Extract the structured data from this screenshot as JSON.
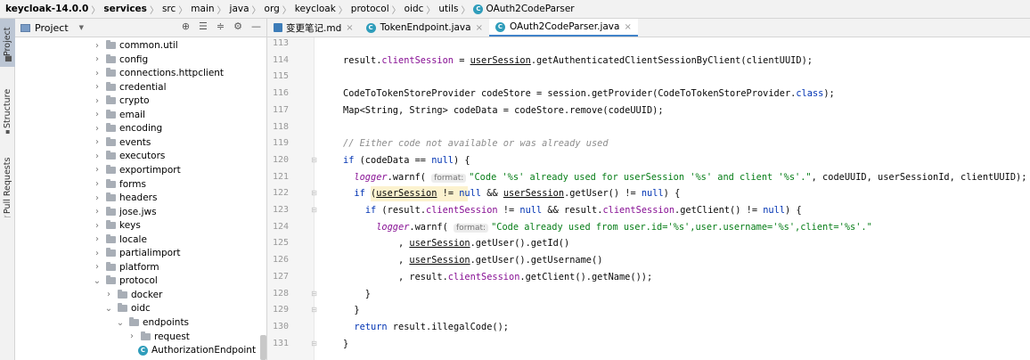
{
  "breadcrumb": [
    "keycloak-14.0.0",
    "services",
    "src",
    "main",
    "java",
    "org",
    "keycloak",
    "protocol",
    "oidc",
    "utils",
    "OAuth2CodeParser"
  ],
  "side_tabs": {
    "project": "Project",
    "structure": "Structure",
    "pull_requests": "Pull Requests"
  },
  "tool_window": {
    "title": "Project",
    "items": [
      {
        "label": "common.util",
        "kind": "folder",
        "indent": 0,
        "arrow": "›"
      },
      {
        "label": "config",
        "kind": "folder",
        "indent": 0,
        "arrow": "›"
      },
      {
        "label": "connections.httpclient",
        "kind": "folder",
        "indent": 0,
        "arrow": "›"
      },
      {
        "label": "credential",
        "kind": "folder",
        "indent": 0,
        "arrow": "›"
      },
      {
        "label": "crypto",
        "kind": "folder",
        "indent": 0,
        "arrow": "›"
      },
      {
        "label": "email",
        "kind": "folder",
        "indent": 0,
        "arrow": "›"
      },
      {
        "label": "encoding",
        "kind": "folder",
        "indent": 0,
        "arrow": "›"
      },
      {
        "label": "events",
        "kind": "folder",
        "indent": 0,
        "arrow": "›"
      },
      {
        "label": "executors",
        "kind": "folder",
        "indent": 0,
        "arrow": "›"
      },
      {
        "label": "exportimport",
        "kind": "folder",
        "indent": 0,
        "arrow": "›"
      },
      {
        "label": "forms",
        "kind": "folder",
        "indent": 0,
        "arrow": "›"
      },
      {
        "label": "headers",
        "kind": "folder",
        "indent": 0,
        "arrow": "›"
      },
      {
        "label": "jose.jws",
        "kind": "folder",
        "indent": 0,
        "arrow": "›"
      },
      {
        "label": "keys",
        "kind": "folder",
        "indent": 0,
        "arrow": "›"
      },
      {
        "label": "locale",
        "kind": "folder",
        "indent": 0,
        "arrow": "›"
      },
      {
        "label": "partialimport",
        "kind": "folder",
        "indent": 0,
        "arrow": "›"
      },
      {
        "label": "platform",
        "kind": "folder",
        "indent": 0,
        "arrow": "›"
      },
      {
        "label": "protocol",
        "kind": "folder",
        "indent": 0,
        "arrow": "⌄"
      },
      {
        "label": "docker",
        "kind": "folder",
        "indent": 1,
        "arrow": "›"
      },
      {
        "label": "oidc",
        "kind": "folder",
        "indent": 1,
        "arrow": "⌄"
      },
      {
        "label": "endpoints",
        "kind": "folder",
        "indent": 2,
        "arrow": "⌄"
      },
      {
        "label": "request",
        "kind": "folder",
        "indent": 3,
        "arrow": "›"
      },
      {
        "label": "AuthorizationEndpoint",
        "kind": "class",
        "indent": 3,
        "arrow": ""
      }
    ]
  },
  "editor_tabs": [
    {
      "label": "变更笔记.md",
      "icon": "markdown-icon",
      "active": false
    },
    {
      "label": "TokenEndpoint.java",
      "icon": "class-icon",
      "active": false
    },
    {
      "label": "OAuth2CodeParser.java",
      "icon": "class-icon",
      "active": true
    }
  ],
  "code_lines": [
    {
      "no": "113",
      "fold": false,
      "html": ""
    },
    {
      "no": "114",
      "fold": false,
      "html": "result.<span class=\"f\">clientSession</span> = <span class=\"u\">userSession</span>.getAuthenticatedClientSessionByClient(clientUUID);"
    },
    {
      "no": "115",
      "fold": false,
      "html": ""
    },
    {
      "no": "116",
      "fold": false,
      "html": "CodeToTokenStoreProvider codeStore = session.getProvider(CodeToTokenStoreProvider.<span class=\"k\">class</span>);"
    },
    {
      "no": "117",
      "fold": false,
      "html": "Map&lt;String, String&gt; codeData = codeStore.remove(codeUUID);"
    },
    {
      "no": "118",
      "fold": false,
      "html": ""
    },
    {
      "no": "119",
      "fold": false,
      "html": "<span class=\"c\">// Either code not available or was already used</span>"
    },
    {
      "no": "120",
      "fold": true,
      "html": "<span class=\"k\">if</span> (codeData == <span class=\"k\">null</span>) {"
    },
    {
      "no": "121",
      "fold": false,
      "html": "  <span class=\"f i\">logger</span>.warnf( <span class=\"h\">format:</span><span class=\"s\">\"Code '%s' already used for userSession '%s' and client '%s'.\"</span>, codeUUID, userSessionId, clientUUID);"
    },
    {
      "no": "122",
      "fold": true,
      "html": "  <span class=\"k\">if</span> (<span class=\"u\">userSession</span> != <span class=\"k\">null</span> &amp;&amp; <span class=\"u\">userSession</span>.getUser() != <span class=\"k\">null</span>) {"
    },
    {
      "no": "123",
      "fold": true,
      "html": "    <span class=\"k\">if</span> (result.<span class=\"f\">clientSession</span> != <span class=\"k\">null</span> &amp;&amp; result.<span class=\"f\">clientSession</span>.getClient() != <span class=\"k\">null</span>) {"
    },
    {
      "no": "124",
      "fold": false,
      "html": "      <span class=\"f i\">logger</span>.warnf( <span class=\"h\">format:</span><span class=\"s\">\"Code already used from user.id='%s',user.username='%s',client='%s'.\"</span>"
    },
    {
      "no": "125",
      "fold": false,
      "html": "          , <span class=\"u\">userSession</span>.getUser().getId()"
    },
    {
      "no": "126",
      "fold": false,
      "html": "          , <span class=\"u\">userSession</span>.getUser().getUsername()"
    },
    {
      "no": "127",
      "fold": false,
      "html": "          , result.<span class=\"f\">clientSession</span>.getClient().getName());"
    },
    {
      "no": "128",
      "fold": true,
      "html": "    }"
    },
    {
      "no": "129",
      "fold": true,
      "html": "  }"
    },
    {
      "no": "130",
      "fold": false,
      "html": "  <span class=\"k\">return</span> result.illegalCode();"
    },
    {
      "no": "131",
      "fold": true,
      "html": "}"
    }
  ]
}
